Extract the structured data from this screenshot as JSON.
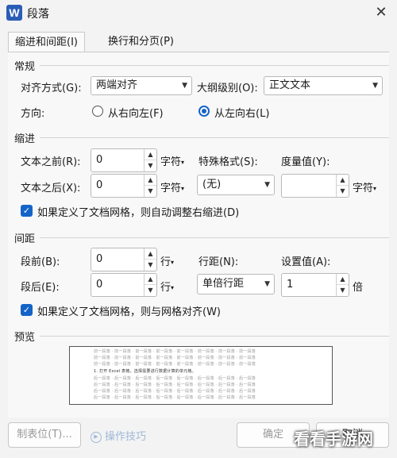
{
  "window": {
    "title": "段落",
    "app_icon_letter": "W"
  },
  "tabs": [
    {
      "label": "缩进和间距(I)",
      "active": true
    },
    {
      "label": "换行和分页(P)",
      "active": false
    }
  ],
  "general": {
    "section_label": "常规",
    "alignment_label": "对齐方式(G):",
    "alignment_value": "两端对齐",
    "outline_label": "大纲级别(O):",
    "outline_value": "正文文本",
    "direction_label": "方向:",
    "rtl_label": "从右向左(F)",
    "ltr_label": "从左向右(L)"
  },
  "indent": {
    "section_label": "缩进",
    "before_label": "文本之前(R):",
    "before_value": "0",
    "before_unit": "字符",
    "after_label": "文本之后(X):",
    "after_value": "0",
    "after_unit": "字符",
    "special_label": "特殊格式(S):",
    "special_value": "(无)",
    "measure_label": "度量值(Y):",
    "measure_value": "",
    "measure_unit": "字符",
    "auto_adjust_label": "如果定义了文档网格，则自动调整右缩进(D)"
  },
  "spacing": {
    "section_label": "间距",
    "before_label": "段前(B):",
    "before_value": "0",
    "before_unit": "行",
    "after_label": "段后(E):",
    "after_value": "0",
    "after_unit": "行",
    "line_label": "行距(N):",
    "line_value": "单倍行距",
    "setting_label": "设置值(A):",
    "setting_value": "1",
    "setting_unit": "倍",
    "grid_align_label": "如果定义了文档网格，则与网格对齐(W)"
  },
  "preview": {
    "section_label": "预览",
    "prev_line": "前一段落 · 前一段落 · 前一段落 · 前一段落 · 前一段落 · 前一段落 · 前一段落 · 前一段落",
    "sample_line": "1. 打开 Excel 表格，选择需要进行数据计算的单元格。",
    "next_line": "后一段落 · 后一段落 · 后一段落 · 后一段落 · 后一段落 · 后一段落 · 后一段落 · 后一段落"
  },
  "footer": {
    "tabs_button": "制表位(T)...",
    "tips_link": "操作技巧",
    "ok_button": "确定",
    "cancel_button": "取消"
  },
  "watermark": "看看手游网"
}
